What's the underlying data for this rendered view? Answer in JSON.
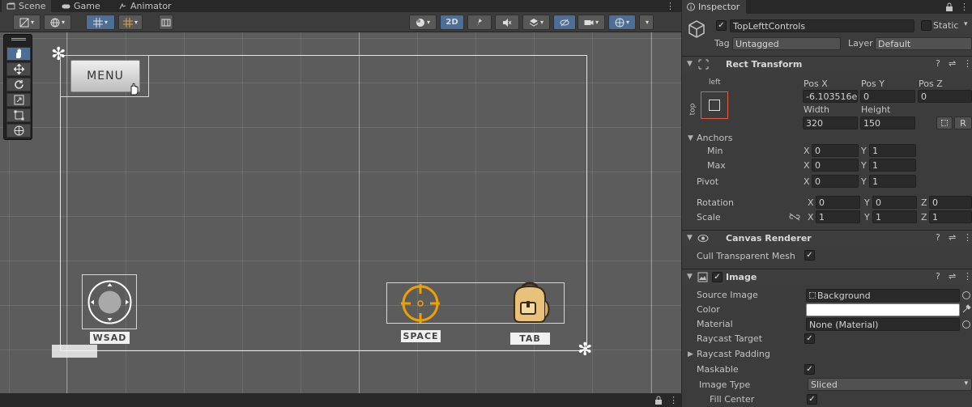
{
  "tabs": [
    {
      "label": "Scene",
      "active": true
    },
    {
      "label": "Game",
      "active": false
    },
    {
      "label": "Animator",
      "active": false
    }
  ],
  "toolbar": {
    "twod_label": "2D"
  },
  "scene": {
    "menu_button_label": "MENU",
    "labels": {
      "wsad": "WSAD",
      "space": "SPACE",
      "tab": "TAB"
    },
    "colors": {
      "crosshair": "#f0a000",
      "backpack": "#e8c27a",
      "selection_blue": "#4d6f96"
    }
  },
  "inspector": {
    "tab_label": "Inspector",
    "object": {
      "name": "TopLefttControls",
      "static_label": "Static",
      "tag_label": "Tag",
      "tag_value": "Untagged",
      "layer_label": "Layer",
      "layer_value": "Default"
    },
    "rect_transform": {
      "title": "Rect Transform",
      "anchor_h": "left",
      "anchor_v": "top",
      "pos_x_label": "Pos X",
      "pos_y_label": "Pos Y",
      "pos_z_label": "Pos Z",
      "pos_x": "-6.103516e-",
      "pos_y": "0",
      "pos_z": "0",
      "width_label": "Width",
      "height_label": "Height",
      "width": "320",
      "height": "150",
      "r_label": "R",
      "anchors_label": "Anchors",
      "min_label": "Min",
      "max_label": "Max",
      "min_x": "0",
      "min_y": "1",
      "max_x": "0",
      "max_y": "1",
      "pivot_label": "Pivot",
      "pivot_x": "0",
      "pivot_y": "1",
      "rotation_label": "Rotation",
      "rot_x": "0",
      "rot_y": "0",
      "rot_z": "0",
      "scale_label": "Scale",
      "scale_x": "1",
      "scale_y": "1",
      "scale_z": "1",
      "x": "X",
      "y": "Y",
      "z": "Z"
    },
    "canvas_renderer": {
      "title": "Canvas Renderer",
      "cull_label": "Cull Transparent Mesh",
      "cull_checked": "✓"
    },
    "image": {
      "title": "Image",
      "enabled": "✓",
      "source_image_label": "Source Image",
      "source_image_value": "Background",
      "color_label": "Color",
      "color_value": "#ffffff",
      "material_label": "Material",
      "material_value": "None (Material)",
      "raycast_target_label": "Raycast Target",
      "raycast_target_checked": "✓",
      "raycast_padding_label": "Raycast Padding",
      "maskable_label": "Maskable",
      "maskable_checked": "✓",
      "image_type_label": "Image Type",
      "image_type_value": "Sliced",
      "fill_center_label": "Fill Center",
      "fill_center_checked": "✓"
    }
  }
}
